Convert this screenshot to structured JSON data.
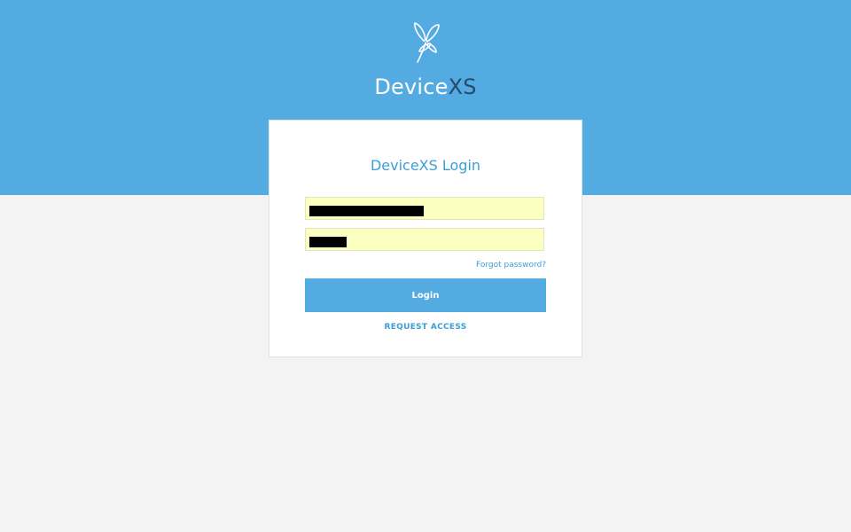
{
  "header": {
    "brand_main": "Device",
    "brand_accent": "XS",
    "logo_icon": "dragonfly-icon",
    "background_color": "#53abe2"
  },
  "login_card": {
    "title": "DeviceXS Login",
    "username_field": {
      "value": "",
      "redacted": true
    },
    "password_field": {
      "value": "",
      "redacted": true
    },
    "forgot_password_label": "Forgot password?",
    "login_button_label": "Login",
    "request_access_label": "REQUEST ACCESS"
  },
  "colors": {
    "accent": "#53abe2",
    "link": "#3a9fd8",
    "autofill_field": "#fbffbf",
    "page_background": "#f3f3f3"
  }
}
